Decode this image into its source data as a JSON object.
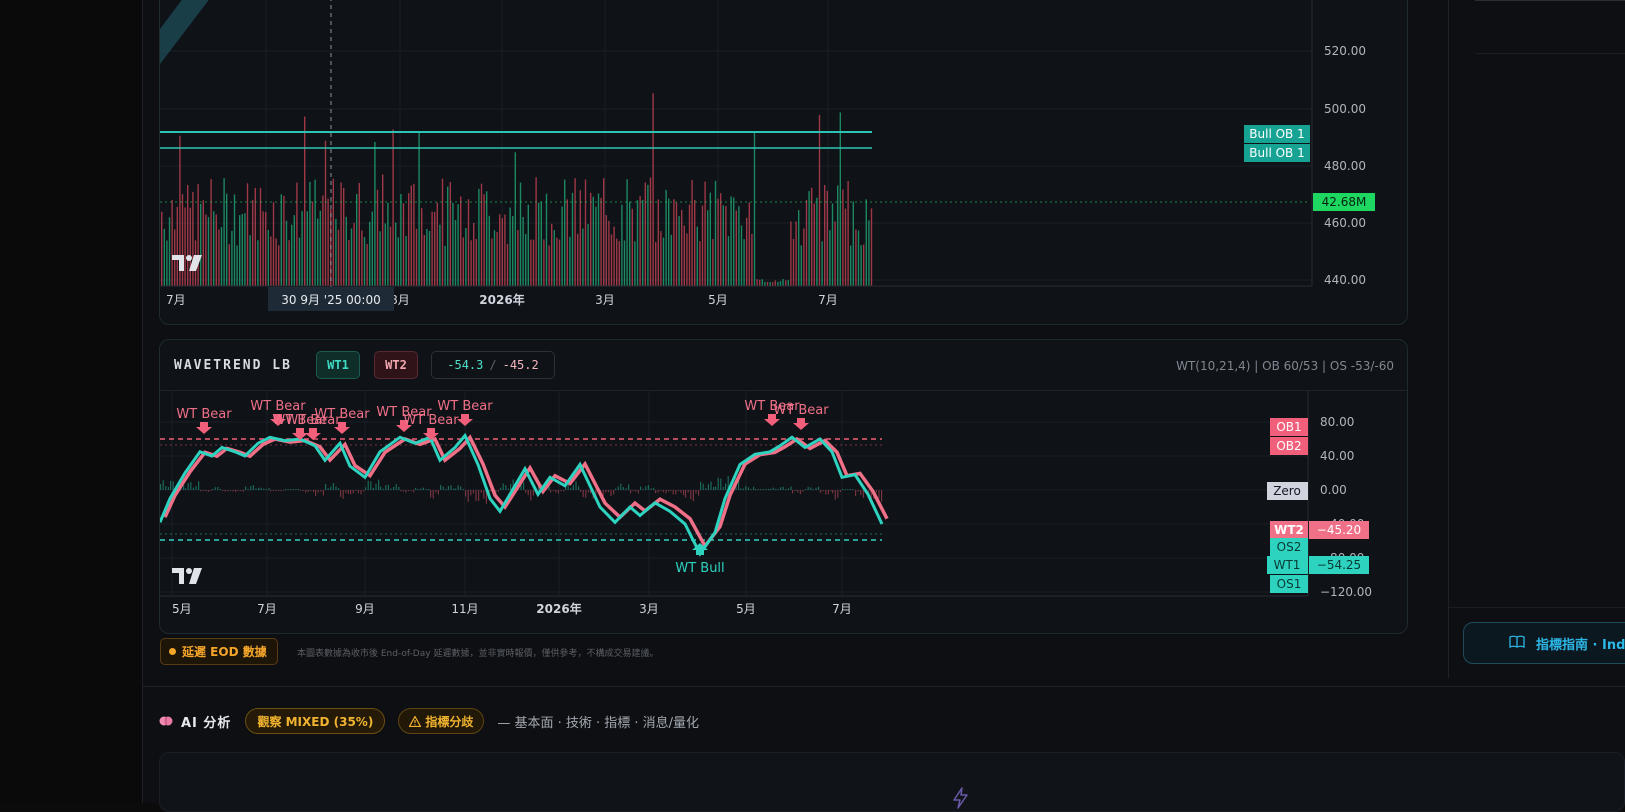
{
  "price_chart": {
    "y_ticks": [
      "520.00",
      "500.00",
      "480.00",
      "460.00",
      "440.00"
    ],
    "x_ticks": [
      "7月",
      "8月",
      "2026年",
      "3月",
      "5月",
      "7月"
    ],
    "crosshair_label": "30 9月 '25   00:00",
    "ob_labels": [
      "Bull OB 1",
      "Bull OB 1"
    ],
    "volume_label": "42.68M",
    "colors": {
      "bull_ob": "#26a69a",
      "up": "#26a69a",
      "down": "#ef5350",
      "volume_badge": "#1ed760"
    }
  },
  "wavetrend": {
    "title": "WAVETREND LB",
    "chip_wt1": "WT1",
    "chip_wt2": "WT2",
    "wt1_value": "-54.3",
    "separator": "/",
    "wt2_value": "-45.2",
    "params": "WT(10,21,4) | OB 60/53 | OS -53/-60",
    "y_ticks": [
      "80.00",
      "40.00",
      "0.00",
      "−40.00",
      "−80.00",
      "−120.00"
    ],
    "x_ticks": [
      "5月",
      "7月",
      "9月",
      "11月",
      "2026年",
      "3月",
      "5月",
      "7月"
    ],
    "level_labels": {
      "ob1": "OB1",
      "ob2": "OB2",
      "zero": "Zero",
      "wt2": "WT2",
      "os2": "OS2",
      "wt1": "WT1",
      "os1": "OS1"
    },
    "value_badges": {
      "wt2": "−45.20",
      "wt1": "−54.25"
    },
    "signals": {
      "bear": "WT Bear",
      "bull": "WT Bull"
    },
    "colors": {
      "wt1": "#2ed3c0",
      "wt2": "#f07088",
      "ob": "#f25f7a",
      "os": "#2ed3c0"
    }
  },
  "eod": {
    "badge": "延遲 EOD 數據",
    "note": "本圖表數據為收市後 End-of-Day 延遲數據，並非實時報價，僅供參考，不構成交易建議。"
  },
  "ai": {
    "title": "AI 分析",
    "badge_mixed": "觀察 MIXED (35%)",
    "badge_divergence": "指標分歧",
    "subtitle": "— 基本面 · 技術 · 指標 · 消息/量化"
  },
  "sidebar": {
    "guide_button": "指標指南 · Ind"
  },
  "icons": [
    "tradingview-logo-icon",
    "book-icon",
    "brain-icon",
    "warning-icon",
    "bolt-icon"
  ]
}
